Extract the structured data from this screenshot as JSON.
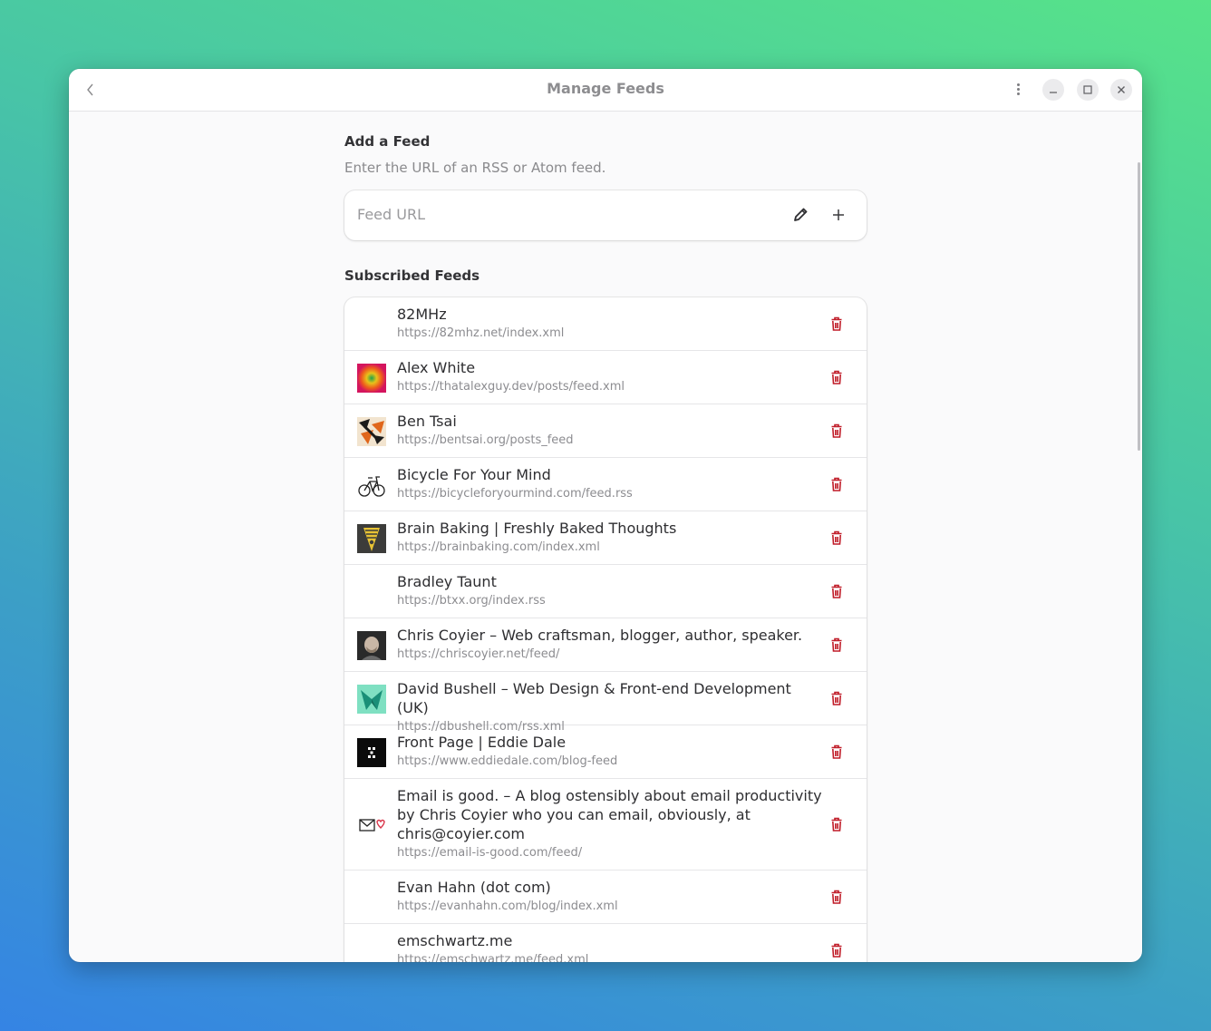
{
  "window": {
    "title": "Manage Feeds"
  },
  "add_feed": {
    "heading": "Add a Feed",
    "description": "Enter the URL of an RSS or Atom feed.",
    "placeholder": "Feed URL"
  },
  "subscribed": {
    "heading": "Subscribed Feeds",
    "feeds": [
      {
        "title": "82MHz",
        "url": "https://82mhz.net/index.xml",
        "icon": "none"
      },
      {
        "title": "Alex White",
        "url": "https://thatalexguy.dev/posts/feed.xml",
        "icon": "alex-white-favicon"
      },
      {
        "title": "Ben Tsai",
        "url": "https://bentsai.org/posts_feed",
        "icon": "ben-tsai-favicon"
      },
      {
        "title": "Bicycle For Your Mind",
        "url": "https://bicycleforyourmind.com/feed.rss",
        "icon": "bicycle-favicon"
      },
      {
        "title": "Brain Baking | Freshly Baked Thoughts",
        "url": "https://brainbaking.com/index.xml",
        "icon": "brain-baking-favicon"
      },
      {
        "title": "Bradley Taunt",
        "url": "https://btxx.org/index.rss",
        "icon": "none"
      },
      {
        "title": "Chris Coyier – Web craftsman, blogger, author, speaker.",
        "url": "https://chriscoyier.net/feed/",
        "icon": "chris-coyier-favicon"
      },
      {
        "title": "David Bushell – Web Design & Front-end Development (UK)",
        "url": "https://dbushell.com/rss.xml",
        "icon": "david-bushell-favicon"
      },
      {
        "title": "Front Page | Eddie Dale",
        "url": "https://www.eddiedale.com/blog-feed",
        "icon": "eddie-dale-favicon"
      },
      {
        "title": "Email is good. – A blog ostensibly about email productivity by Chris Coyier who you can email, obviously, at chris@coyier.com",
        "url": "https://email-is-good.com/feed/",
        "icon": "email-heart-favicon"
      },
      {
        "title": "Evan Hahn (dot com)",
        "url": "https://evanhahn.com/blog/index.xml",
        "icon": "none"
      },
      {
        "title": "emschwartz.me",
        "url": "https://emschwartz.me/feed.xml",
        "icon": "none"
      }
    ]
  },
  "colors": {
    "delete": "#c01c28",
    "accent": "#3584e4"
  }
}
